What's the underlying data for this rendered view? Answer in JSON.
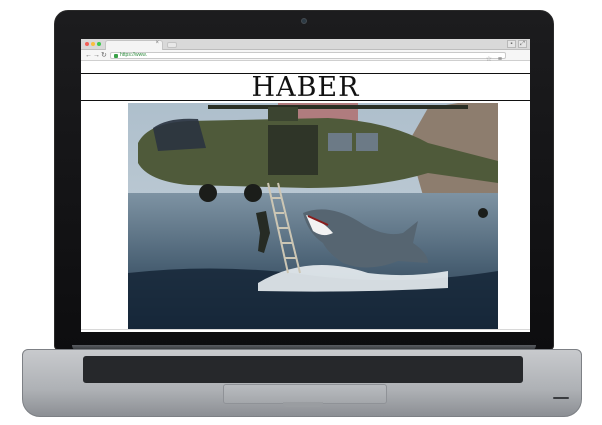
{
  "browser": {
    "tab_close_glyph": "×",
    "url": "https://www.",
    "icons": [
      "back-arrow-icon",
      "forward-arrow-icon",
      "reload-icon",
      "lock-icon",
      "star-icon",
      "menu-icon"
    ]
  },
  "page": {
    "masthead_title": "HABER"
  },
  "colors": {
    "traffic_red": "#f25f58",
    "traffic_yellow": "#f9be3e",
    "traffic_green": "#3bc84f",
    "url_green": "#2e8b3e",
    "laptop_bezel": "#111111",
    "laptop_aluminum": "#b8bbbf"
  }
}
